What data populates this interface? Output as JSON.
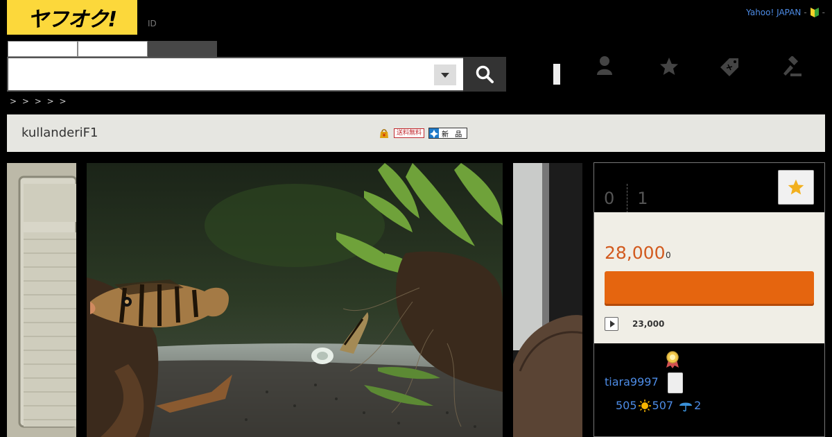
{
  "header": {
    "logo_text": "ヤフオク!",
    "id_label": "ID",
    "top_link": "Yahoo! JAPAN",
    "separator": "-",
    "trailing": "-"
  },
  "breadcrumb": "> > > > >",
  "item": {
    "title": "kullanderiF1",
    "badge_free_shipping": "送料無料",
    "badge_new": "新 品"
  },
  "auction": {
    "count_watch": "0",
    "count_bids": "1",
    "current_price": "28,000",
    "price_suffix": "0",
    "buy_now_price": "23,000"
  },
  "seller": {
    "name": "tiara9997",
    "rating_total": "505",
    "rating_good": "507",
    "rating_bad": "2"
  },
  "colors": {
    "logo_bg": "#fcd83b",
    "accent_orange": "#e5650f",
    "price_color": "#d25a1e",
    "link_blue": "#4d8ce6"
  }
}
